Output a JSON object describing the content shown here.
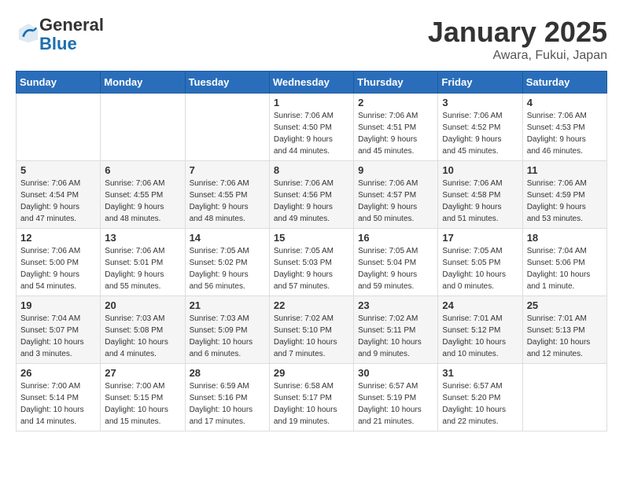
{
  "header": {
    "logo_general": "General",
    "logo_blue": "Blue",
    "month_title": "January 2025",
    "location": "Awara, Fukui, Japan"
  },
  "weekdays": [
    "Sunday",
    "Monday",
    "Tuesday",
    "Wednesday",
    "Thursday",
    "Friday",
    "Saturday"
  ],
  "weeks": [
    [
      {
        "day": "",
        "info": ""
      },
      {
        "day": "",
        "info": ""
      },
      {
        "day": "",
        "info": ""
      },
      {
        "day": "1",
        "info": "Sunrise: 7:06 AM\nSunset: 4:50 PM\nDaylight: 9 hours\nand 44 minutes."
      },
      {
        "day": "2",
        "info": "Sunrise: 7:06 AM\nSunset: 4:51 PM\nDaylight: 9 hours\nand 45 minutes."
      },
      {
        "day": "3",
        "info": "Sunrise: 7:06 AM\nSunset: 4:52 PM\nDaylight: 9 hours\nand 45 minutes."
      },
      {
        "day": "4",
        "info": "Sunrise: 7:06 AM\nSunset: 4:53 PM\nDaylight: 9 hours\nand 46 minutes."
      }
    ],
    [
      {
        "day": "5",
        "info": "Sunrise: 7:06 AM\nSunset: 4:54 PM\nDaylight: 9 hours\nand 47 minutes."
      },
      {
        "day": "6",
        "info": "Sunrise: 7:06 AM\nSunset: 4:55 PM\nDaylight: 9 hours\nand 48 minutes."
      },
      {
        "day": "7",
        "info": "Sunrise: 7:06 AM\nSunset: 4:55 PM\nDaylight: 9 hours\nand 48 minutes."
      },
      {
        "day": "8",
        "info": "Sunrise: 7:06 AM\nSunset: 4:56 PM\nDaylight: 9 hours\nand 49 minutes."
      },
      {
        "day": "9",
        "info": "Sunrise: 7:06 AM\nSunset: 4:57 PM\nDaylight: 9 hours\nand 50 minutes."
      },
      {
        "day": "10",
        "info": "Sunrise: 7:06 AM\nSunset: 4:58 PM\nDaylight: 9 hours\nand 51 minutes."
      },
      {
        "day": "11",
        "info": "Sunrise: 7:06 AM\nSunset: 4:59 PM\nDaylight: 9 hours\nand 53 minutes."
      }
    ],
    [
      {
        "day": "12",
        "info": "Sunrise: 7:06 AM\nSunset: 5:00 PM\nDaylight: 9 hours\nand 54 minutes."
      },
      {
        "day": "13",
        "info": "Sunrise: 7:06 AM\nSunset: 5:01 PM\nDaylight: 9 hours\nand 55 minutes."
      },
      {
        "day": "14",
        "info": "Sunrise: 7:05 AM\nSunset: 5:02 PM\nDaylight: 9 hours\nand 56 minutes."
      },
      {
        "day": "15",
        "info": "Sunrise: 7:05 AM\nSunset: 5:03 PM\nDaylight: 9 hours\nand 57 minutes."
      },
      {
        "day": "16",
        "info": "Sunrise: 7:05 AM\nSunset: 5:04 PM\nDaylight: 9 hours\nand 59 minutes."
      },
      {
        "day": "17",
        "info": "Sunrise: 7:05 AM\nSunset: 5:05 PM\nDaylight: 10 hours\nand 0 minutes."
      },
      {
        "day": "18",
        "info": "Sunrise: 7:04 AM\nSunset: 5:06 PM\nDaylight: 10 hours\nand 1 minute."
      }
    ],
    [
      {
        "day": "19",
        "info": "Sunrise: 7:04 AM\nSunset: 5:07 PM\nDaylight: 10 hours\nand 3 minutes."
      },
      {
        "day": "20",
        "info": "Sunrise: 7:03 AM\nSunset: 5:08 PM\nDaylight: 10 hours\nand 4 minutes."
      },
      {
        "day": "21",
        "info": "Sunrise: 7:03 AM\nSunset: 5:09 PM\nDaylight: 10 hours\nand 6 minutes."
      },
      {
        "day": "22",
        "info": "Sunrise: 7:02 AM\nSunset: 5:10 PM\nDaylight: 10 hours\nand 7 minutes."
      },
      {
        "day": "23",
        "info": "Sunrise: 7:02 AM\nSunset: 5:11 PM\nDaylight: 10 hours\nand 9 minutes."
      },
      {
        "day": "24",
        "info": "Sunrise: 7:01 AM\nSunset: 5:12 PM\nDaylight: 10 hours\nand 10 minutes."
      },
      {
        "day": "25",
        "info": "Sunrise: 7:01 AM\nSunset: 5:13 PM\nDaylight: 10 hours\nand 12 minutes."
      }
    ],
    [
      {
        "day": "26",
        "info": "Sunrise: 7:00 AM\nSunset: 5:14 PM\nDaylight: 10 hours\nand 14 minutes."
      },
      {
        "day": "27",
        "info": "Sunrise: 7:00 AM\nSunset: 5:15 PM\nDaylight: 10 hours\nand 15 minutes."
      },
      {
        "day": "28",
        "info": "Sunrise: 6:59 AM\nSunset: 5:16 PM\nDaylight: 10 hours\nand 17 minutes."
      },
      {
        "day": "29",
        "info": "Sunrise: 6:58 AM\nSunset: 5:17 PM\nDaylight: 10 hours\nand 19 minutes."
      },
      {
        "day": "30",
        "info": "Sunrise: 6:57 AM\nSunset: 5:19 PM\nDaylight: 10 hours\nand 21 minutes."
      },
      {
        "day": "31",
        "info": "Sunrise: 6:57 AM\nSunset: 5:20 PM\nDaylight: 10 hours\nand 22 minutes."
      },
      {
        "day": "",
        "info": ""
      }
    ]
  ]
}
